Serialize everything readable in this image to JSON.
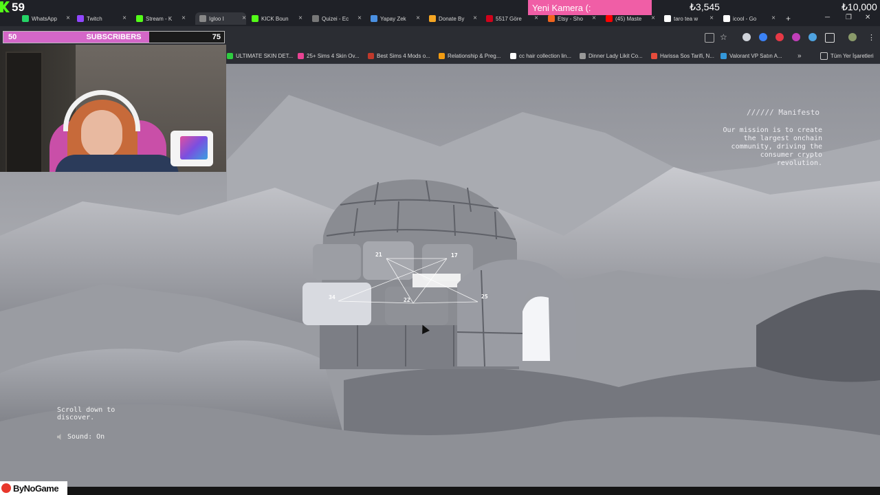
{
  "stream": {
    "viewer_count": "59",
    "yeni_kamera": "Yeni Kamera (:",
    "goal_current": "₺3,545",
    "goal_target": "₺10,000",
    "subscribers": {
      "current": "50",
      "label": "SUBSCRIBERS",
      "goal": "75",
      "progress": 0.66
    },
    "sponsor": "ByNoGame"
  },
  "browser": {
    "tabs": [
      {
        "label": "WhatsApp",
        "color": "#25d366"
      },
      {
        "label": "Twitch",
        "color": "#9146ff"
      },
      {
        "label": "Stream - K",
        "color": "#53fc18"
      },
      {
        "label": "Igloo I",
        "color": "#888888"
      },
      {
        "label": "KICK Boun",
        "color": "#53fc18"
      },
      {
        "label": "Quizei - Ec",
        "color": "#777777"
      },
      {
        "label": "Yapay Zek",
        "color": "#4a90e2"
      },
      {
        "label": "Donate By",
        "color": "#f5a623"
      },
      {
        "label": "5517 Göre",
        "color": "#d0021b"
      },
      {
        "label": "Etsy - Sho",
        "color": "#f1641e"
      },
      {
        "label": "(45) Maste",
        "color": "#ff0000"
      },
      {
        "label": "taro tea w",
        "color": "#ffffff"
      },
      {
        "label": "icool - Go",
        "color": "#ffffff"
      }
    ],
    "new_tab": "+",
    "bookmarks": [
      {
        "label": "ULTIMATE SKIN DET...",
        "color": "#2ecc40"
      },
      {
        "label": "25+ Sims 4 Skin Ov...",
        "color": "#e84393"
      },
      {
        "label": "Best Sims 4 Mods o...",
        "color": "#c0392b"
      },
      {
        "label": "Relationship & Preg...",
        "color": "#f39c12"
      },
      {
        "label": "cc hair collection lin...",
        "color": "#ffffff"
      },
      {
        "label": "Dinner Lady Likit Co...",
        "color": "#999999"
      },
      {
        "label": "Harissa Sos Tarifi, N...",
        "color": "#e74c3c"
      },
      {
        "label": "Valorant VP Satın A...",
        "color": "#3498db"
      }
    ],
    "bookmarks_more": "»",
    "all_bookmarks": "Tüm Yer İşaretleri"
  },
  "page": {
    "manifesto_title": "////// Manifesto",
    "manifesto_text": "Our mission is to create the largest onchain community, driving the consumer crypto revolution.",
    "scroll_hint": "Scroll down to discover.",
    "sound_label": "Sound: On",
    "nodes": [
      "21",
      "17",
      "34",
      "22",
      "25"
    ]
  },
  "icons": {
    "sound": "speaker-icon",
    "star": "bookmark-star-icon",
    "translate": "translate-icon",
    "extensions": "puzzle-icon",
    "menu": "kebab-menu-icon"
  }
}
